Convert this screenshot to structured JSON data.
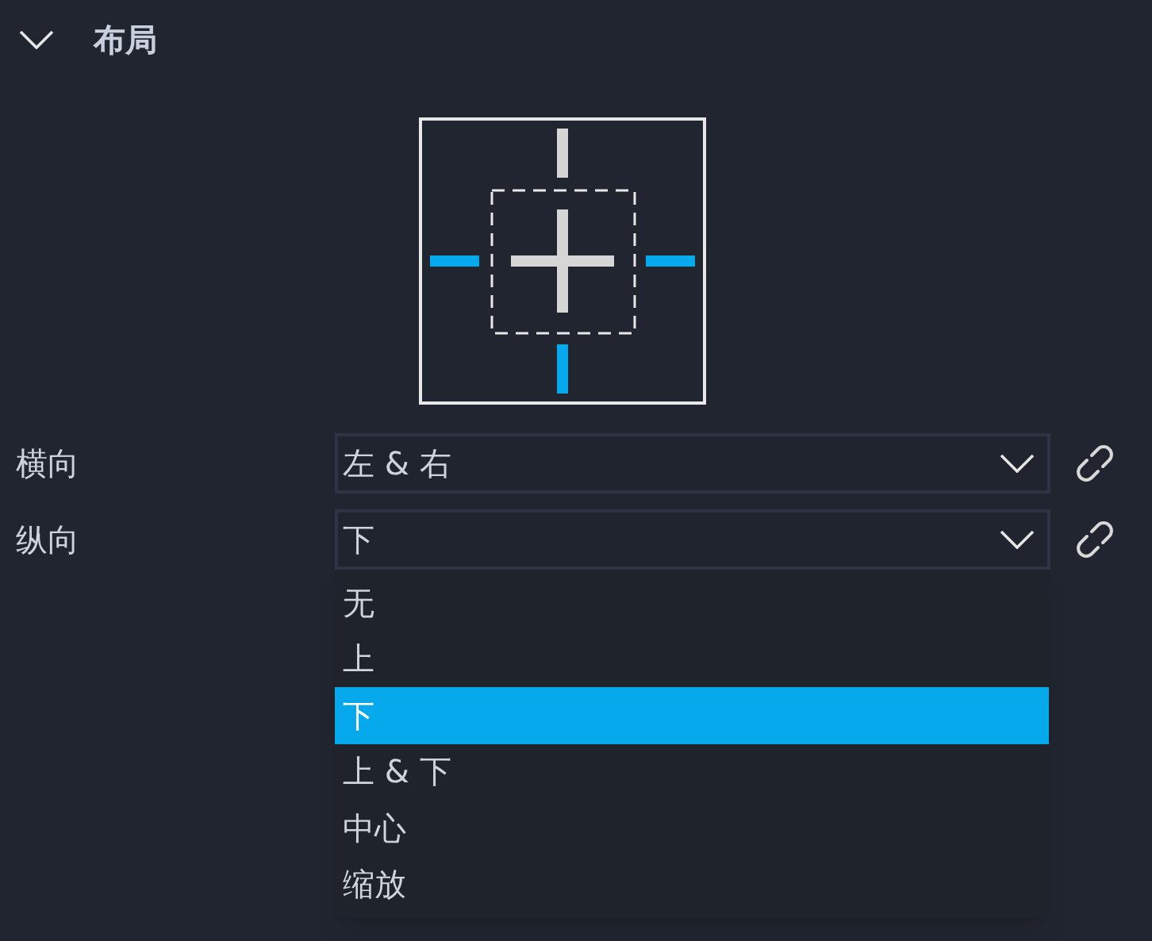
{
  "section": {
    "title": "布局",
    "expanded": true
  },
  "anchor": {
    "top": false,
    "left": true,
    "right": true,
    "bottom": true
  },
  "fields": [
    {
      "label": "横向",
      "value": "左 & 右",
      "open": false
    },
    {
      "label": "纵向",
      "value": "下",
      "open": true
    }
  ],
  "dropdown": {
    "options": [
      {
        "label": "无",
        "selected": false
      },
      {
        "label": "上",
        "selected": false
      },
      {
        "label": "下",
        "selected": true
      },
      {
        "label": "上 & 下",
        "selected": false
      },
      {
        "label": "中心",
        "selected": false
      },
      {
        "label": "缩放",
        "selected": false
      }
    ]
  }
}
